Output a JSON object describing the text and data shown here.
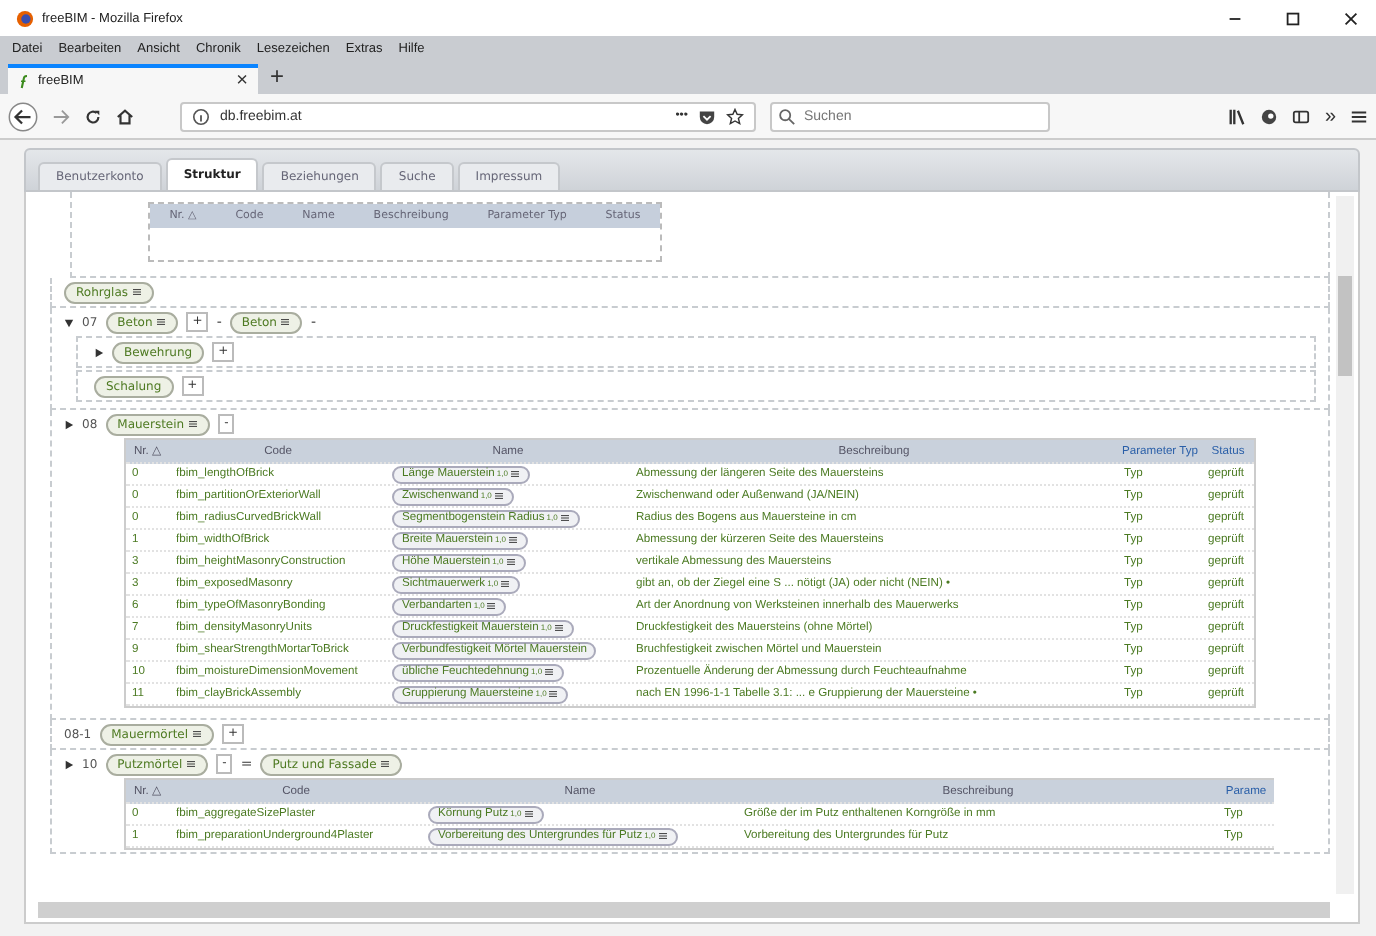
{
  "window": {
    "title": "freeBIM - Mozilla Firefox"
  },
  "menu": [
    "Datei",
    "Bearbeiten",
    "Ansicht",
    "Chronik",
    "Lesezeichen",
    "Extras",
    "Hilfe"
  ],
  "browser_tab": {
    "title": "freeBIM",
    "close": "×",
    "new_tab": "+"
  },
  "toolbar": {
    "url": "db.freebim.at",
    "more": "•••",
    "overflow": "»",
    "search": {
      "placeholder": "Suchen"
    }
  },
  "app_tabs": [
    {
      "label": "Benutzerkonto",
      "selected": false
    },
    {
      "label": "Struktur",
      "selected": true
    },
    {
      "label": "Beziehungen",
      "selected": false
    },
    {
      "label": "Suche",
      "selected": false
    },
    {
      "label": "Impressum",
      "selected": false
    }
  ],
  "empty_table": {
    "columns": [
      "Nr. △",
      "Code",
      "Name",
      "Beschreibung",
      "Parameter Typ",
      "Status"
    ]
  },
  "sections": [
    {
      "items": [
        {
          "kind": "chip",
          "label": "Rohrglas",
          "icon": true
        }
      ]
    },
    {
      "number": "07",
      "expanded": true,
      "items": [
        {
          "kind": "chip",
          "label": "Beton",
          "icon": true
        },
        {
          "kind": "button",
          "label": "+"
        },
        {
          "kind": "text",
          "label": "-"
        },
        {
          "kind": "chip",
          "label": "Beton",
          "icon": true
        },
        {
          "kind": "text",
          "label": "-"
        }
      ],
      "children": [
        {
          "expanded": false,
          "items": [
            {
              "kind": "chip",
              "label": "Bewehrung",
              "icon": false
            },
            {
              "kind": "button",
              "label": "+"
            }
          ]
        },
        {
          "items": [
            {
              "kind": "chip",
              "label": "Schalung",
              "icon": false
            },
            {
              "kind": "button",
              "label": "+"
            }
          ]
        }
      ]
    },
    {
      "number": "08",
      "expanded": false,
      "items": [
        {
          "kind": "chip",
          "label": "Mauerstein",
          "icon": true
        },
        {
          "kind": "button",
          "label": "-"
        }
      ],
      "table": {
        "columns": [
          "Nr. △",
          "Code",
          "Name",
          "Beschreibung",
          "Parameter Typ",
          "Status"
        ],
        "rows": [
          {
            "nr": "0",
            "code": "fbim_lengthOfBrick",
            "name": {
              "label": "Länge Mauerstein",
              "version": "1,0",
              "icon": true
            },
            "description": "Abmessung der längeren Seite des Mauersteins",
            "type": "Typ",
            "status": "geprüft"
          },
          {
            "nr": "0",
            "code": "fbim_partitionOrExteriorWall",
            "name": {
              "label": "Zwischenwand",
              "version": "1,0",
              "icon": true
            },
            "description": "Zwischenwand oder Außenwand (JA/NEIN)",
            "type": "Typ",
            "status": "geprüft"
          },
          {
            "nr": "0",
            "code": "fbim_radiusCurvedBrickWall",
            "name": {
              "label": "Segmentbogenstein Radius",
              "version": "1,0",
              "icon": true
            },
            "description": "Radius des Bogens aus Mauersteine in cm",
            "type": "Typ",
            "status": "geprüft"
          },
          {
            "nr": "1",
            "code": "fbim_widthOfBrick",
            "name": {
              "label": "Breite Mauerstein",
              "version": "1,0",
              "icon": true
            },
            "description": "Abmessung der kürzeren Seite des Mauersteins",
            "type": "Typ",
            "status": "geprüft"
          },
          {
            "nr": "3",
            "code": "fbim_heightMasonryConstruction",
            "name": {
              "label": "Höhe Mauerstein",
              "version": "1,0",
              "icon": true
            },
            "description": "vertikale Abmessung des Mauersteins",
            "type": "Typ",
            "status": "geprüft"
          },
          {
            "nr": "3",
            "code": "fbim_exposedMasonry",
            "name": {
              "label": "Sichtmauerwerk",
              "version": "1,0",
              "icon": true
            },
            "description": "gibt an, ob der Ziegel eine S ... nötigt (JA) oder nicht (NEIN) •",
            "type": "Typ",
            "status": "geprüft"
          },
          {
            "nr": "6",
            "code": "fbim_typeOfMasonryBonding",
            "name": {
              "label": "Verbandarten",
              "version": "1,0",
              "icon": true
            },
            "description": "Art der Anordnung von Werksteinen innerhalb des Mauerwerks",
            "type": "Typ",
            "status": "geprüft"
          },
          {
            "nr": "7",
            "code": "fbim_densityMasonryUnits",
            "name": {
              "label": "Druckfestigkeit Mauerstein",
              "version": "1,0",
              "icon": true
            },
            "description": "Druckfestigkeit des Mauersteins (ohne Mörtel)",
            "type": "Typ",
            "status": "geprüft"
          },
          {
            "nr": "9",
            "code": "fbim_shearStrengthMortarToBrick",
            "name": {
              "label": "Verbundfestigkeit Mörtel Mauerstein",
              "icon": false
            },
            "description": "Bruchfestigkeit zwischen Mörtel und Mauerstein",
            "type": "Typ",
            "status": "geprüft"
          },
          {
            "nr": "10",
            "code": "fbim_moistureDimensionMovement",
            "name": {
              "label": "übliche Feuchtedehnung",
              "version": "1,0",
              "icon": true
            },
            "description": "Prozentuelle Änderung der Abmessung durch Feuchteaufnahme",
            "type": "Typ",
            "status": "geprüft"
          },
          {
            "nr": "11",
            "code": "fbim_clayBrickAssembly",
            "name": {
              "label": "Gruppierung Mauersteine",
              "version": "1,0",
              "icon": true
            },
            "description": "nach EN 1996-1-1 Tabelle 3.1: ... e Gruppierung der Mauersteine •",
            "type": "Typ",
            "status": "geprüft"
          }
        ]
      }
    },
    {
      "number": "08-1",
      "items": [
        {
          "kind": "chip",
          "label": "Mauermörtel",
          "icon": true
        },
        {
          "kind": "button",
          "label": "+"
        }
      ]
    },
    {
      "number": "10",
      "expanded": false,
      "items": [
        {
          "kind": "chip",
          "label": "Putzmörtel",
          "icon": true
        },
        {
          "kind": "button",
          "label": "-"
        },
        {
          "kind": "text",
          "label": "="
        },
        {
          "kind": "chip",
          "label": "Putz und Fassade",
          "icon": true
        }
      ],
      "table": {
        "columns": [
          "Nr. △",
          "Code",
          "Name",
          "Beschreibung",
          "Parame"
        ],
        "rows": [
          {
            "nr": "0",
            "code": "fbim_aggregateSizePlaster",
            "name": {
              "label": "Körnung Putz",
              "version": "1,0",
              "icon": true
            },
            "description": "Größe der im Putz enthaltenen Korngröße in mm",
            "type": "Typ"
          },
          {
            "nr": "1",
            "code": "fbim_preparationUnderground4Plaster",
            "name": {
              "label": "Vorbereitung des Untergrundes für Putz",
              "version": "1,0",
              "icon": true
            },
            "description": "Vorbereitung des Untergrundes für Putz",
            "type": "Typ"
          }
        ]
      }
    }
  ]
}
